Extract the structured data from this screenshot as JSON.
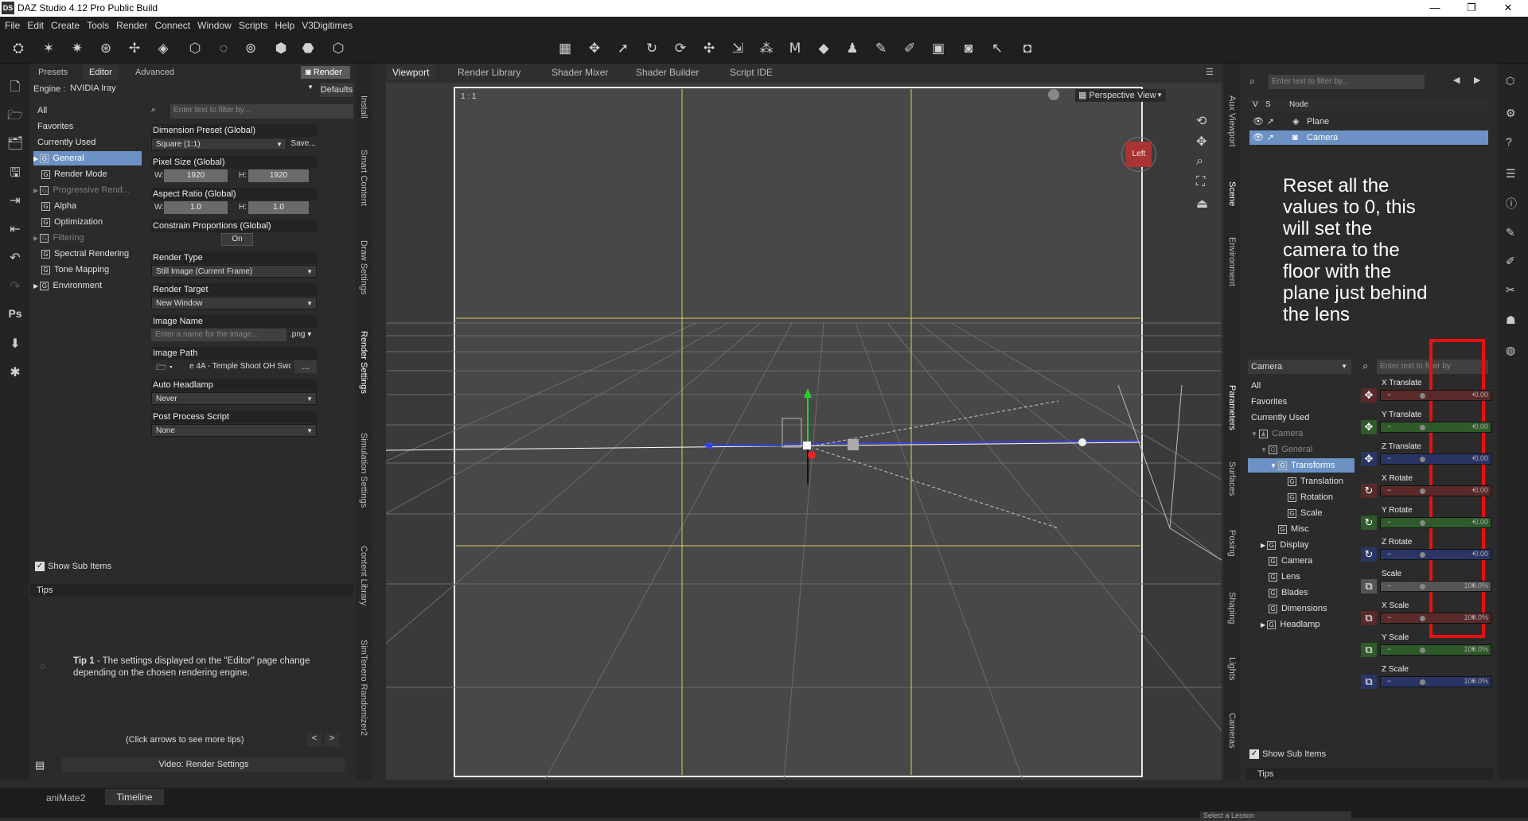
{
  "titlebar": {
    "logo": "DS",
    "title": "DAZ Studio 4.12 Pro Public Build"
  },
  "menu": [
    "File",
    "Edit",
    "Create",
    "Tools",
    "Render",
    "Connect",
    "Window",
    "Scripts",
    "Help",
    "V3Digitimes"
  ],
  "left_tabs": {
    "presets": "Presets",
    "editor": "Editor",
    "advanced": "Advanced",
    "render": "Render"
  },
  "engine": {
    "label": "Engine :",
    "value": "NVIDIA Iray",
    "defaults": "Defaults"
  },
  "filter_placeholder": "Enter text to filter by...",
  "left_tree": [
    {
      "label": "All"
    },
    {
      "label": "Favorites"
    },
    {
      "label": "Currently Used"
    },
    {
      "label": "General",
      "group": true,
      "expander": true,
      "selected": true
    },
    {
      "label": "Render Mode",
      "group": true
    },
    {
      "label": "Progressive Rend...",
      "group": true,
      "expander": true,
      "dim": true
    },
    {
      "label": "Alpha",
      "group": true
    },
    {
      "label": "Optimization",
      "group": true
    },
    {
      "label": "Filtering",
      "group": true,
      "expander": true,
      "dim": true
    },
    {
      "label": "Spectral Rendering",
      "group": true
    },
    {
      "label": "Tone Mapping",
      "group": true
    },
    {
      "label": "Environment",
      "group": true,
      "expander": true
    }
  ],
  "props": {
    "dim_preset": {
      "label": "Dimension Preset (Global)",
      "value": "Square (1:1)",
      "save": "Save..."
    },
    "pixel_size": {
      "label": "Pixel Size (Global)",
      "w_label": "W:",
      "w": "1920",
      "h_label": "H:",
      "h": "1920"
    },
    "aspect": {
      "label": "Aspect Ratio (Global)",
      "w_label": "W:",
      "w": "1.0",
      "h_label": "H:",
      "h": "1.0"
    },
    "constrain": {
      "label": "Constrain Proportions (Global)",
      "value": "On"
    },
    "render_type": {
      "label": "Render Type",
      "value": "Still Image (Current Frame)"
    },
    "render_target": {
      "label": "Render Target",
      "value": "New Window"
    },
    "image_name": {
      "label": "Image Name",
      "placeholder": "Enter a name for the image...",
      "ext": ".png"
    },
    "image_path": {
      "label": "Image Path",
      "value": "e 4A - Temple Shoot OH Sword",
      "more": "..."
    },
    "auto_headlamp": {
      "label": "Auto Headlamp",
      "value": "Never"
    },
    "post_process": {
      "label": "Post Process Script",
      "value": "None"
    }
  },
  "show_sub_items": "Show Sub Items",
  "tips": {
    "title": "Tips",
    "tip_bold": "Tip 1",
    "tip_text": " - The settings displayed on the \"Editor\" page change depending on the chosen rendering engine.",
    "hint": "(Click arrows to see more tips)",
    "prev": "<",
    "next": ">",
    "video": "Video: Render Settings"
  },
  "left_vtabs": [
    "Install",
    "Smart Content",
    "Draw Settings",
    "Render Settings",
    "Simulation Settings",
    "Content Library",
    "SimTenero Randomizer2"
  ],
  "viewport_tabs": [
    "Viewport",
    "Render Library",
    "Shader Mixer",
    "Shader Builder",
    "Script IDE"
  ],
  "viewport": {
    "ratio": "1 : 1",
    "view": "Perspective View",
    "cube": "Left"
  },
  "scene": {
    "filter_placeholder": "Enter text to filter by...",
    "cols": [
      "V",
      "S",
      "Node"
    ],
    "nodes": [
      {
        "label": "Plane",
        "selected": false
      },
      {
        "label": "Camera",
        "selected": true
      }
    ]
  },
  "right_vtabs_top": [
    "Aux Viewport",
    "Scene",
    "Environment"
  ],
  "right_vtabs_bottom": [
    "Parameters",
    "Surfaces",
    "Posing",
    "Shaping",
    "Lights",
    "Cameras"
  ],
  "annotation": "Reset all the values to 0, this will set the camera to the floor with the plane just behind the lens",
  "params": {
    "node": "Camera",
    "filter_placeholder": "Enter text to filter by",
    "tree": [
      {
        "label": "All",
        "indent": 0
      },
      {
        "label": "Favorites",
        "indent": 0
      },
      {
        "label": "Currently Used",
        "indent": 0
      },
      {
        "label": "Camera",
        "indent": 0,
        "expander": "▼",
        "dim": true,
        "kind": "figure"
      },
      {
        "label": "General",
        "indent": 1,
        "expander": "▼",
        "dim": true,
        "kind": "group"
      },
      {
        "label": "Transforms",
        "indent": 2,
        "expander": "▼",
        "selected": true,
        "kind": "group"
      },
      {
        "label": "Translation",
        "indent": 3,
        "kind": "group"
      },
      {
        "label": "Rotation",
        "indent": 3,
        "kind": "group"
      },
      {
        "label": "Scale",
        "indent": 3,
        "kind": "group"
      },
      {
        "label": "Misc",
        "indent": 2,
        "kind": "group"
      },
      {
        "label": "Display",
        "indent": 1,
        "expander": "▶",
        "kind": "group"
      },
      {
        "label": "Camera",
        "indent": 1,
        "kind": "group"
      },
      {
        "label": "Lens",
        "indent": 1,
        "kind": "group"
      },
      {
        "label": "Blades",
        "indent": 1,
        "kind": "group"
      },
      {
        "label": "Dimensions",
        "indent": 1,
        "kind": "group"
      },
      {
        "label": "Headlamp",
        "indent": 1,
        "expander": "▶",
        "kind": "group"
      }
    ],
    "sliders": [
      {
        "label": "X Translate",
        "value": "0.00",
        "color": "#5a2a2a",
        "icon": "✥"
      },
      {
        "label": "Y Translate",
        "value": "0.00",
        "color": "#2f5a2a",
        "icon": "✥"
      },
      {
        "label": "Z Translate",
        "value": "0.00",
        "color": "#2a3566",
        "icon": "✥"
      },
      {
        "label": "X Rotate",
        "value": "0.00",
        "color": "#5a2a2a",
        "icon": "↻"
      },
      {
        "label": "Y Rotate",
        "value": "0.00",
        "color": "#2f5a2a",
        "icon": "↻"
      },
      {
        "label": "Z Rotate",
        "value": "0.00",
        "color": "#2a3566",
        "icon": "↻"
      },
      {
        "label": "Scale",
        "value": "100.0%",
        "color": "#555555",
        "icon": "⧉"
      },
      {
        "label": "X Scale",
        "value": "100.0%",
        "color": "#5a2a2a",
        "icon": "⧉"
      },
      {
        "label": "Y Scale",
        "value": "100.0%",
        "color": "#2f5a2a",
        "icon": "⧉"
      },
      {
        "label": "Z Scale",
        "value": "100.0%",
        "color": "#2a3566",
        "icon": "⧉"
      }
    ],
    "show_sub_items": "Show Sub Items",
    "tips": "Tips"
  },
  "bottom_tabs": [
    "aniMate2",
    "Timeline"
  ],
  "lesson": "Select a Lesson"
}
